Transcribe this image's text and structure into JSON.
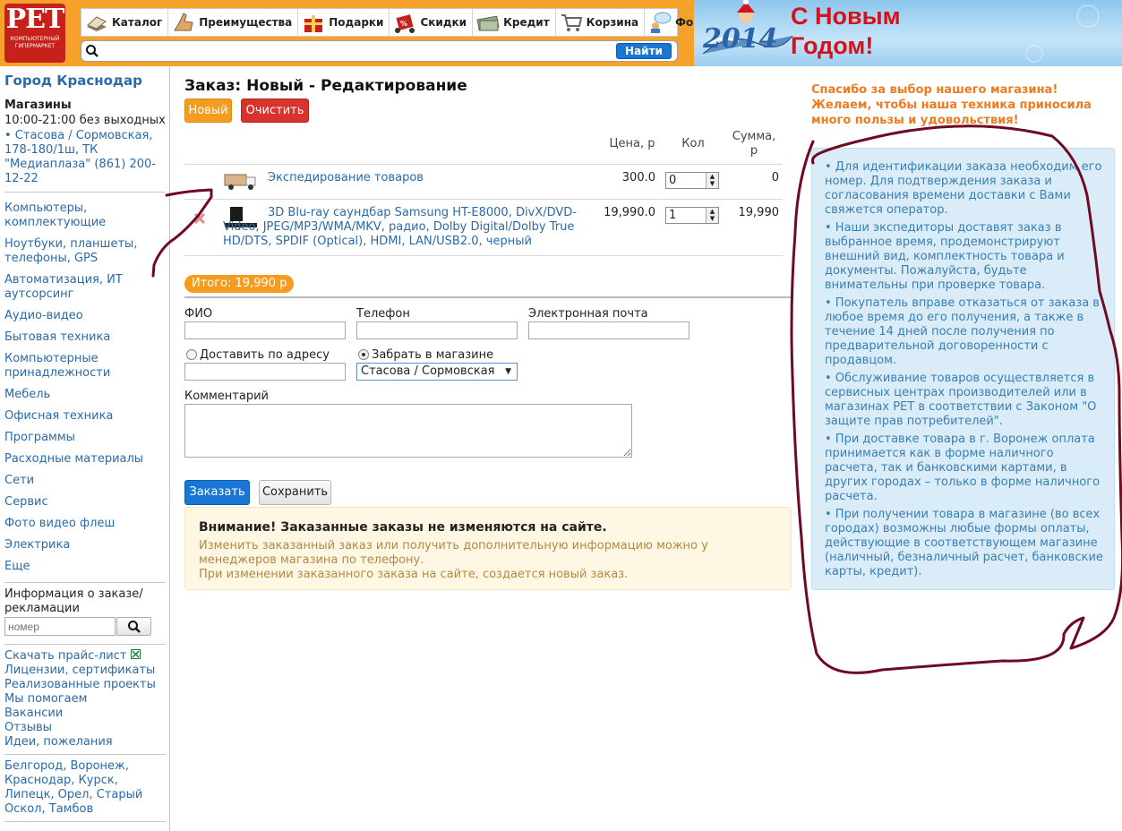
{
  "header": {
    "logo": {
      "text": "PET",
      "subtitle": "КОМПЬЮТЕРНЫЙ ГИПЕРМАРКЕТ"
    },
    "nav": [
      {
        "label": "Каталог",
        "icon": "book-icon"
      },
      {
        "label": "Преимущества",
        "icon": "thumbs-up-icon"
      },
      {
        "label": "Подарки",
        "icon": "gift-icon"
      },
      {
        "label": "Скидки",
        "icon": "discount-tag-icon"
      },
      {
        "label": "Кредит",
        "icon": "money-icon"
      },
      {
        "label": "Корзина",
        "icon": "cart-icon"
      },
      {
        "label": "Форум",
        "icon": "forum-icon"
      }
    ],
    "search": {
      "value": "",
      "placeholder": "",
      "button": "Найти"
    },
    "banner": {
      "line1": "С Новым",
      "line2": "Годом!",
      "year": "2014"
    }
  },
  "sidebar": {
    "city": "Город Краснодар",
    "stores_title": "Магазины",
    "stores_hours": "10:00-21:00 без выходных",
    "stores_address": "• Стасова / Сормовская, 178-180/1ш, ТК \"Медиаплаза\" (861) 200-12-22",
    "categories": [
      "Компьютеры, комплектующие",
      "Ноутбуки, планшеты, телефоны, GPS",
      "Автоматизация, ИТ аутсорсинг",
      "Аудио-видео",
      "Бытовая техника",
      "Компьютерные принадлежности",
      "Мебель",
      "Офисная техника",
      "Программы",
      "Расходные материалы",
      "Сети",
      "Сервис",
      "Фото видео флеш",
      "Электрика",
      "Еще"
    ],
    "order_info_label": "Информация о заказе/рекламации",
    "order_number_placeholder": "номер",
    "info_links": [
      "Скачать прайс-лист",
      "Лицензии, сертификаты",
      "Реализованные проекты",
      "Мы помогаем",
      "Вакансии",
      "Отзывы",
      "Идеи, пожелания"
    ],
    "cities": "Белгород, Воронеж, Краснодар, Курск, Липецк, Орел, Старый Оскол, Тамбов"
  },
  "order": {
    "title": "Заказ: Новый - Редактирование",
    "btn_new": "Новый",
    "btn_clear": "Очистить",
    "columns": {
      "price": "Цена, р",
      "qty": "Кол",
      "sum": "Сумма, р"
    },
    "items": [
      {
        "name": "Экспедирование товаров",
        "price": "300.0",
        "qty": "0",
        "sum": "0",
        "icon": "delivery-van-icon"
      },
      {
        "name": "3D Blu-ray саундбар Samsung HT-E8000, DivX/DVD-Video, JPEG/MP3/WMA/MKV, радио, Dolby Digital/Dolby True HD/DTS, SPDIF (Optical), HDMI, LAN/USB2.0, черный",
        "price": "19,990.0",
        "qty": "1",
        "sum": "19,990",
        "icon": "soundbar-icon"
      }
    ],
    "total": "Итого: 19,990 р"
  },
  "form": {
    "fio_label": "ФИО",
    "phone_label": "Телефон",
    "email_label": "Электронная почта",
    "deliver_label": "Доставить по адресу",
    "pickup_label": "Забрать в магазине",
    "store_value": "Стасова / Сормовская",
    "comment_label": "Комментарий",
    "btn_order": "Заказать",
    "btn_save": "Сохранить"
  },
  "notice": {
    "title": "Внимание! Заказанные заказы не изменяются на сайте.",
    "line1": "Изменить заказанный заказ или получить дополнительную информацию можно у менеджеров магазина по телефону.",
    "line2": "При изменении заказанного заказа на сайте, создается новый заказ."
  },
  "right": {
    "thanks": "Спасибо за выбор нашего магазина! Желаем, чтобы наша техника приносила много пользы и удовольствия!",
    "bullets": [
      "• Для идентификации заказа необходим его номер. Для подтверждения заказа и согласования времени доставки с Вами свяжется оператор.",
      "• Наши экспедиторы доставят заказ в выбранное время, продемонстрируют внешний вид, комплектность товара и документы. Пожалуйста, будьте внимательны при проверке товара.",
      "• Покупатель вправе отказаться от заказа в любое время до его получения, а также в течение 14 дней после получения по предварительной договоренности с продавцом.",
      "• Обслуживание товаров осуществляется в сервисных центрах производителей или в магазинах PET в соответствии с Законом \"О защите прав потребителей\".",
      "• При доставке товара в г. Воронеж оплата принимается как в форме наличного расчета, так и банковскими картами, в других городах – только в форме наличного расчета.",
      "• При получении товара в магазине (во всех городах) возможны любые формы оплаты, действующие в соответствующем магазине (наличный, безналичный расчет, банковские карты, кредит)."
    ]
  },
  "colors": {
    "accent": "#f39c1f",
    "link": "#2a6aa8",
    "danger": "#d9332e",
    "primary": "#1a76d2",
    "annotation": "#6e0a22"
  }
}
